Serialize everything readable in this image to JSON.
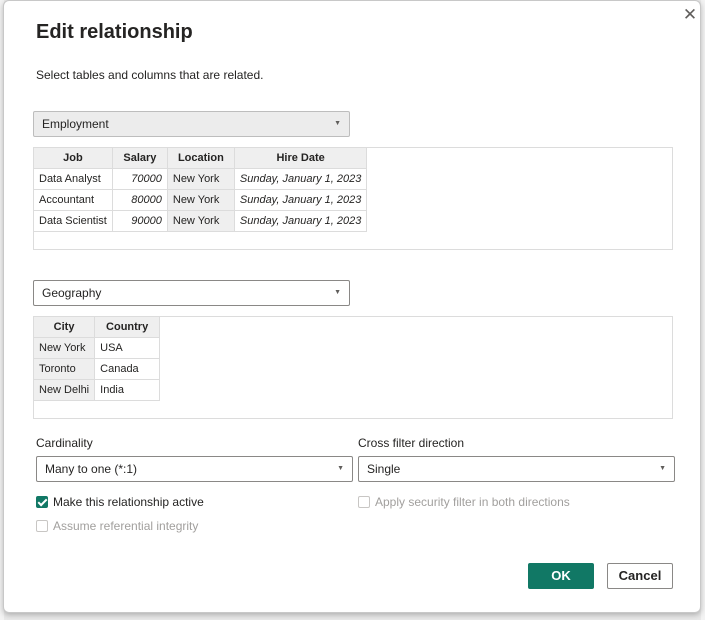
{
  "dialog": {
    "title": "Edit relationship",
    "subtitle": "Select tables and columns that are related.",
    "close_icon": "close-icon"
  },
  "table1": {
    "selected": "Employment",
    "columns": [
      "Job",
      "Salary",
      "Location",
      "Hire Date"
    ],
    "rows": [
      [
        "Data Analyst",
        "70000",
        "New York",
        "Sunday, January 1, 2023"
      ],
      [
        "Accountant",
        "80000",
        "New York",
        "Sunday, January 1, 2023"
      ],
      [
        "Data Scientist",
        "90000",
        "New York",
        "Sunday, January 1, 2023"
      ]
    ]
  },
  "table2": {
    "selected": "Geography",
    "columns": [
      "City",
      "Country"
    ],
    "rows": [
      [
        "New York",
        "USA"
      ],
      [
        "Toronto",
        "Canada"
      ],
      [
        "New Delhi",
        "India"
      ]
    ]
  },
  "cardinality": {
    "label": "Cardinality",
    "value": "Many to one (*:1)"
  },
  "cross_filter": {
    "label": "Cross filter direction",
    "value": "Single"
  },
  "options": {
    "active_label": "Make this relationship active",
    "active_checked": true,
    "referential_label": "Assume referential integrity",
    "referential_checked": false,
    "security_label": "Apply security filter in both directions",
    "security_checked": false
  },
  "buttons": {
    "ok": "OK",
    "cancel": "Cancel"
  },
  "colors": {
    "accent": "#117865",
    "selected_column": "#efefef"
  }
}
